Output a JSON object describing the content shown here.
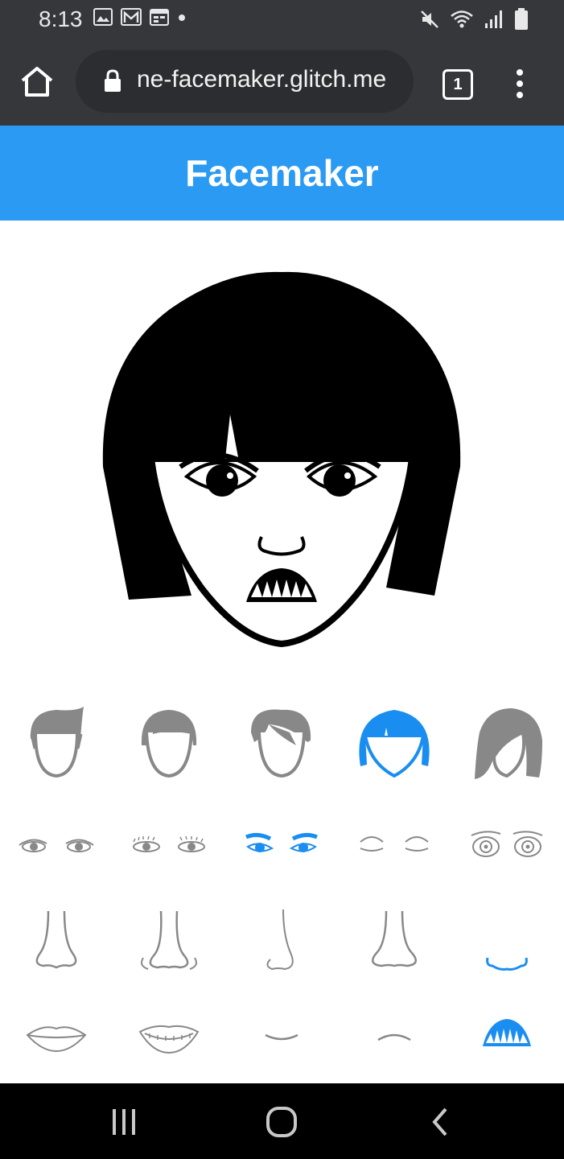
{
  "status_bar": {
    "time": "8:13",
    "left_icons": [
      "image-icon",
      "gmail-icon",
      "calendar-icon",
      "dot-icon"
    ],
    "right_icons": [
      "mute-icon",
      "wifi-icon",
      "signal-icon",
      "battery-icon"
    ]
  },
  "browser": {
    "url": "ne-facemaker.glitch.me",
    "tab_count": "1"
  },
  "app": {
    "title": "Facemaker"
  },
  "options": {
    "hair": [
      "hair-style-1",
      "hair-style-2",
      "hair-style-3",
      "hair-style-4",
      "hair-style-5"
    ],
    "eyes": [
      "eyes-style-1",
      "eyes-style-2",
      "eyes-style-3",
      "eyes-style-4",
      "eyes-style-5"
    ],
    "nose": [
      "nose-style-1",
      "nose-style-2",
      "nose-style-3",
      "nose-style-4",
      "nose-style-5"
    ],
    "mouth": [
      "mouth-style-1",
      "mouth-style-2",
      "mouth-style-3",
      "mouth-style-4",
      "mouth-style-5"
    ],
    "selected": {
      "hair": 4,
      "eyes": 3,
      "nose": 5,
      "mouth": 5
    }
  },
  "colors": {
    "accent": "#2b9af3",
    "option_gray": "#888888",
    "selected_blue": "#1a8ef0",
    "status_bar": "#35373b",
    "nav_bar": "#000000"
  }
}
